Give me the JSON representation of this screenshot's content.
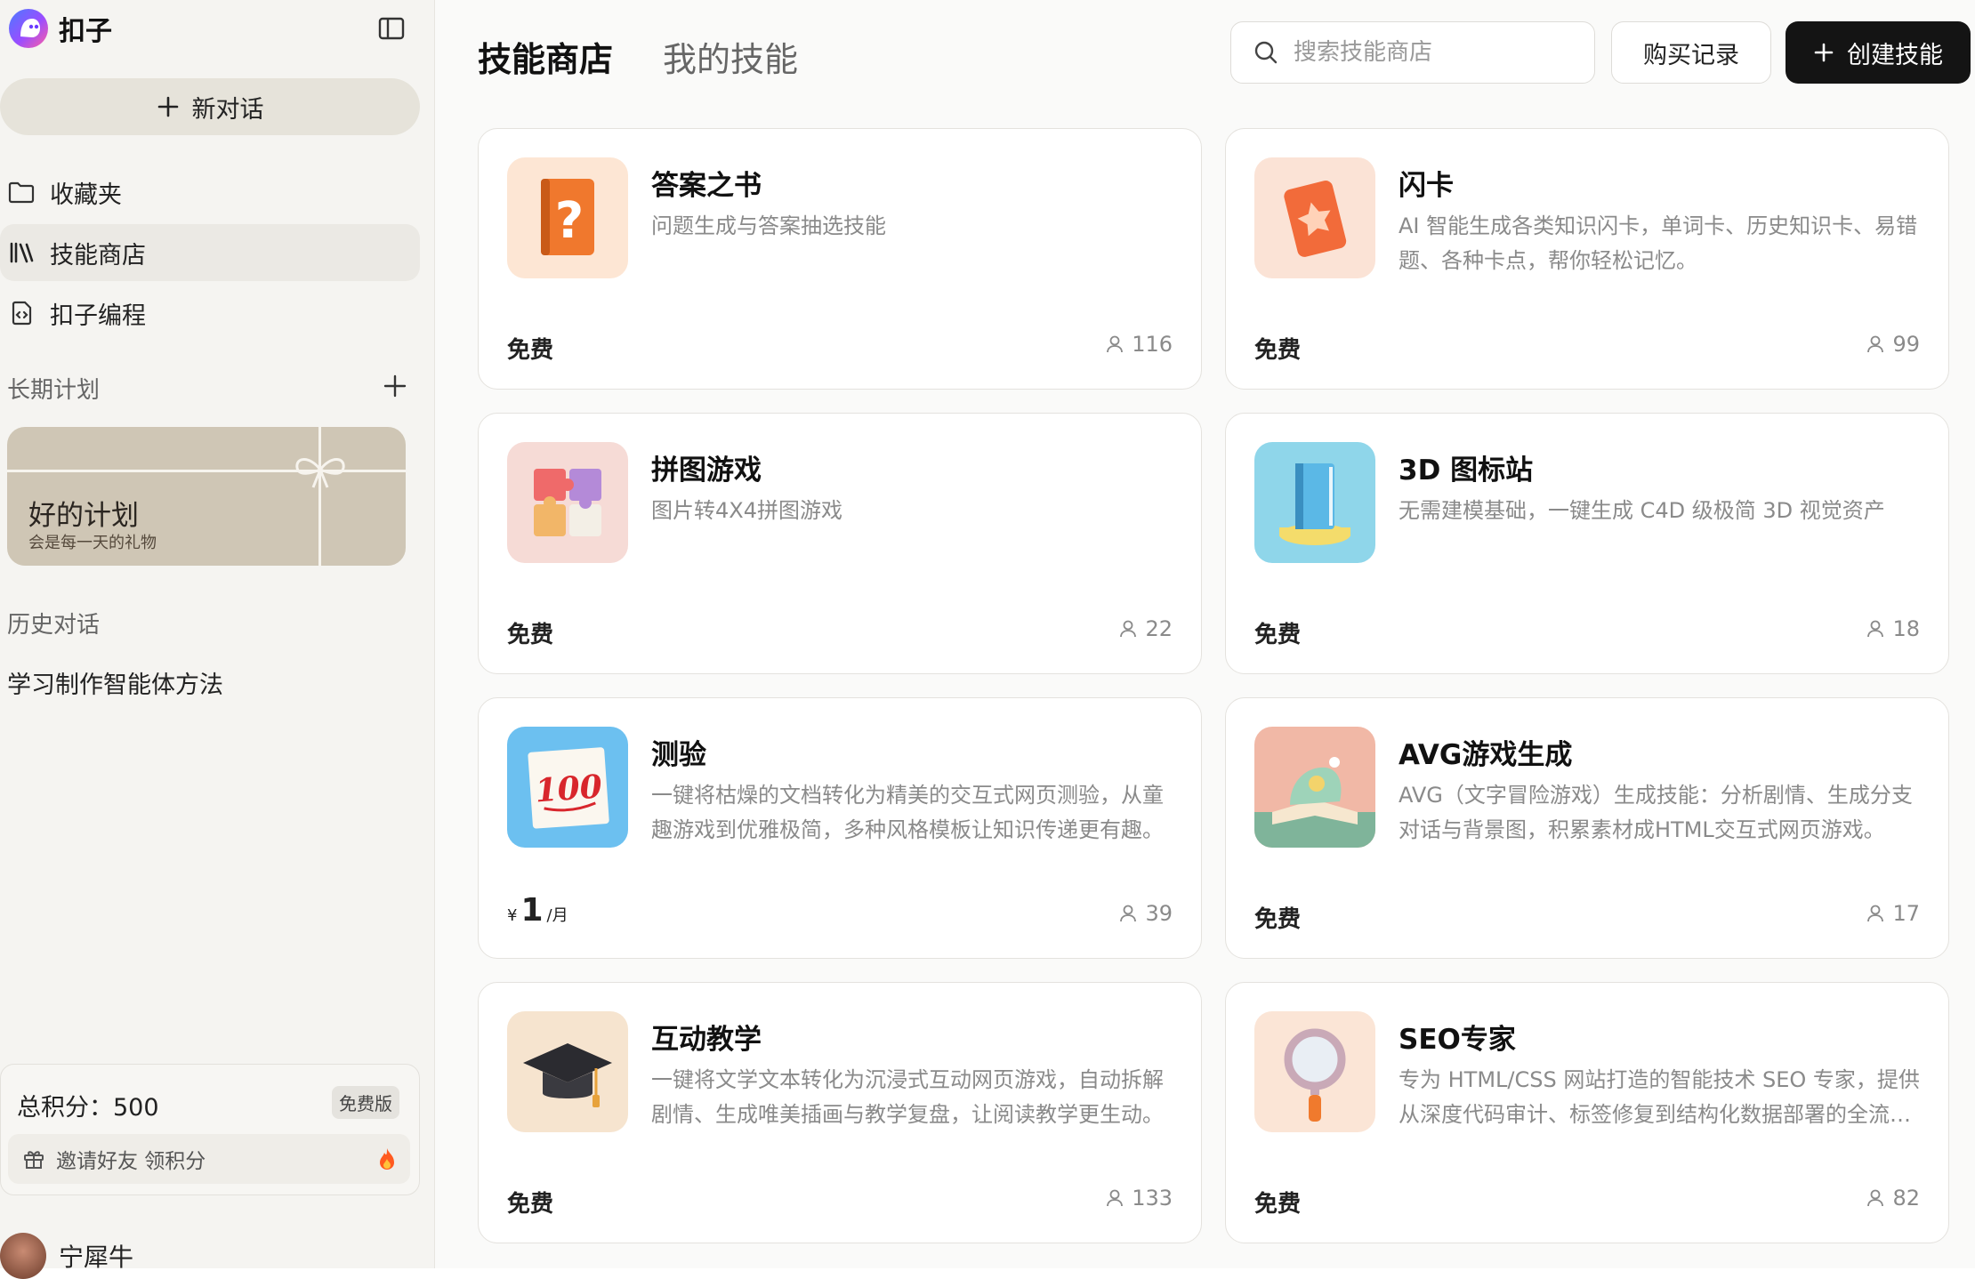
{
  "brand": {
    "name": "扣子"
  },
  "sidebar": {
    "new_chat": "新对话",
    "nav": [
      {
        "label": "收藏夹",
        "icon": "folder-icon"
      },
      {
        "label": "技能商店",
        "icon": "library-icon"
      },
      {
        "label": "扣子编程",
        "icon": "code-file-icon"
      }
    ],
    "long_term_title": "长期计划",
    "plan_card": {
      "title": "好的计划",
      "subtitle": "会是每一天的礼物"
    },
    "history_title": "历史对话",
    "history": [
      "学习制作智能体方法"
    ],
    "points": {
      "label": "总积分：500",
      "badge": "免费版",
      "invite": "邀请好友 领积分"
    },
    "user": {
      "name": "宁犀牛"
    }
  },
  "header": {
    "tabs": [
      "技能商店",
      "我的技能"
    ],
    "search_placeholder": "搜索技能商店",
    "purchase_label": "购买记录",
    "create_label": "创建技能"
  },
  "skills": [
    {
      "title": "答案之书",
      "desc": "问题生成与答案抽选技能",
      "price": "免费",
      "users": "116",
      "icon": "question-book-icon"
    },
    {
      "title": "闪卡",
      "desc": "AI 智能生成各类知识闪卡，单词卡、历史知识卡、易错题、各种卡点，帮你轻松记忆。",
      "price": "免费",
      "users": "99",
      "icon": "flash-card-icon"
    },
    {
      "title": "拼图游戏",
      "desc": "图片转4X4拼图游戏",
      "price": "免费",
      "users": "22",
      "icon": "puzzle-icon"
    },
    {
      "title": "3D 图标站",
      "desc": "无需建模基础，一键生成 C4D 级极简 3D 视觉资产",
      "price": "免费",
      "users": "18",
      "icon": "3d-book-icon"
    },
    {
      "title": "测验",
      "desc": "一键将枯燥的文档转化为精美的交互式网页测验，从童趣游戏到优雅极简，多种风格模板让知识传递更有趣。",
      "price_currency": "¥",
      "price_amount": "1",
      "price_unit": "/月",
      "users": "39",
      "icon": "score-100-icon"
    },
    {
      "title": "AVG游戏生成",
      "desc": "AVG（文字冒险游戏）生成技能：分析剧情、生成分支对话与背景图，积累素材成HTML交互式网页游戏。",
      "price": "免费",
      "users": "17",
      "icon": "storybook-icon"
    },
    {
      "title": "互动教学",
      "desc": "一键将文学文本转化为沉浸式互动网页游戏，自动拆解剧情、生成唯美插画与教学复盘，让阅读教学更生动。",
      "price": "免费",
      "users": "133",
      "icon": "graduation-cap-icon"
    },
    {
      "title": "SEO专家",
      "desc": "专为 HTML/CSS 网站打造的智能技术 SEO 专家，提供从深度代码审计、标签修复到结构化数据部署的全流程服务。",
      "price": "免费",
      "users": "82",
      "icon": "magnifier-icon"
    }
  ]
}
